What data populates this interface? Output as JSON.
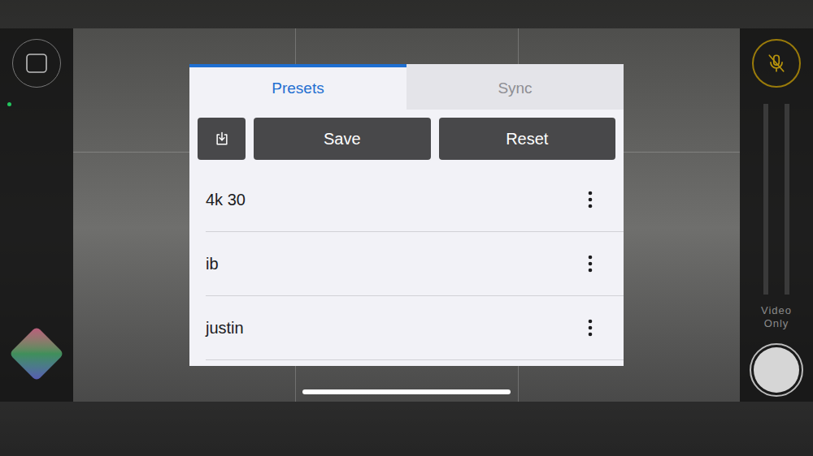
{
  "tabs": [
    {
      "label": "Presets",
      "selected": true
    },
    {
      "label": "Sync",
      "selected": false
    }
  ],
  "toolbar": {
    "buttons": [
      "Save",
      "Reset"
    ]
  },
  "presets": [
    {
      "name": "4k 30"
    },
    {
      "name": "ib"
    },
    {
      "name": "justin"
    }
  ],
  "side": {
    "status_dot": {
      "color": "#22c55e"
    },
    "mic": {
      "muted": true
    },
    "meters": [
      {
        "level": 0
      },
      {
        "level": 0
      }
    ],
    "mode_label": "Video Only"
  }
}
